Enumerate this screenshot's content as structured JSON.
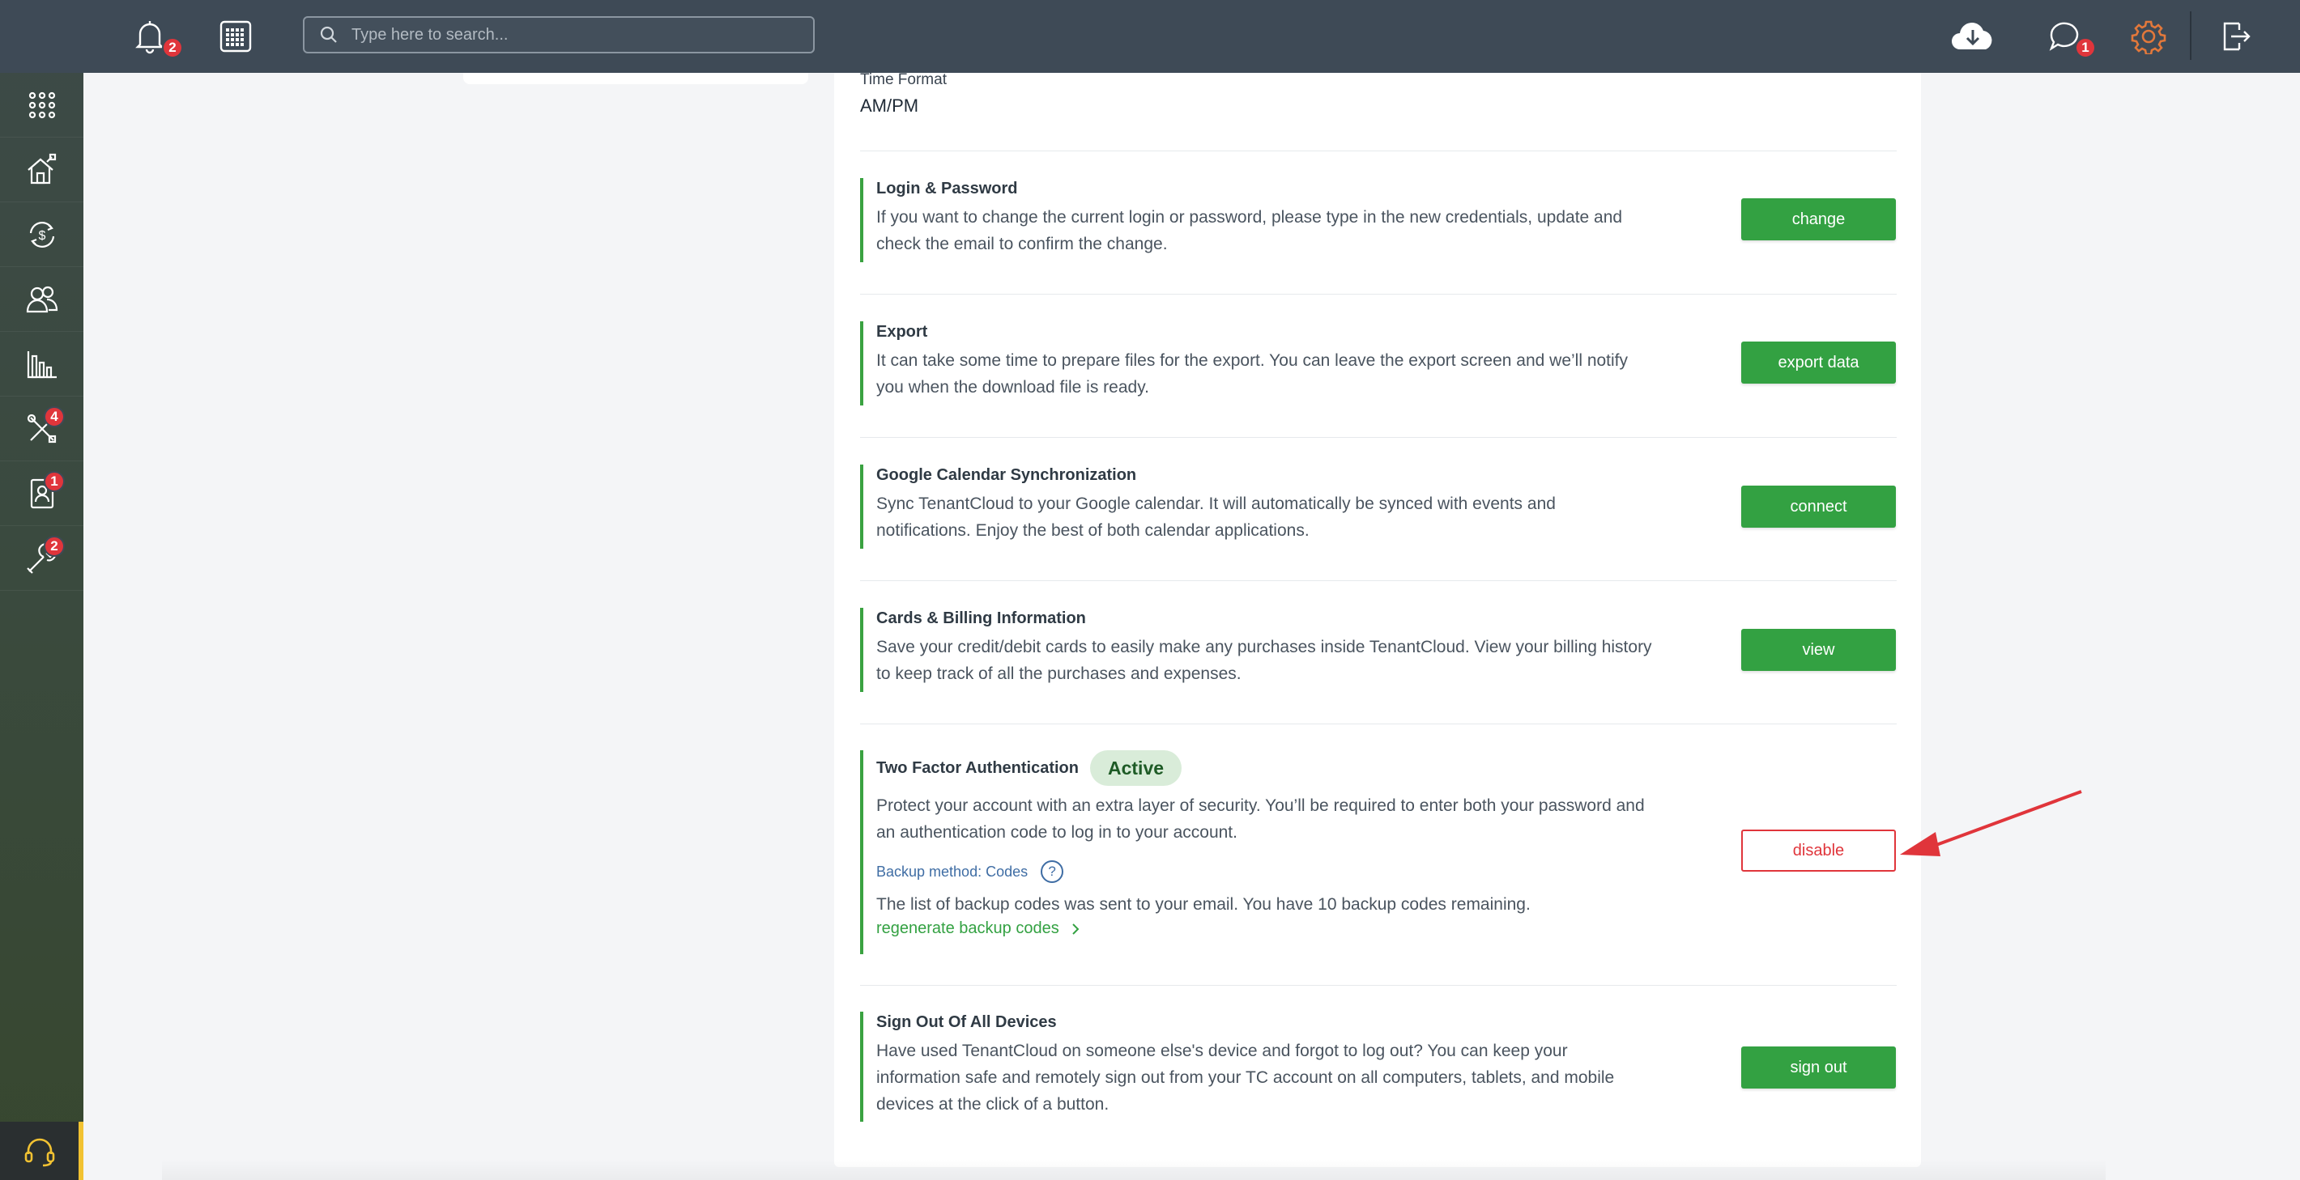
{
  "search": {
    "placeholder": "Type here to search..."
  },
  "badges": {
    "notifications": "2",
    "messages": "1",
    "tools": "4",
    "contacts": "1",
    "maintenance": "2"
  },
  "icons": {
    "notifications": "bell-icon",
    "calendar": "calendar-grid-icon",
    "search": "search-icon",
    "download": "cloud-download-icon",
    "messages": "chat-icon",
    "settings": "gear-icon",
    "logout": "logout-icon",
    "apps": "apps-grid-icon",
    "properties": "house-icon",
    "payments": "dollar-cycle-icon",
    "people": "people-icon",
    "reports": "bar-chart-icon",
    "tools": "tools-icon",
    "contacts": "contact-card-icon",
    "maintenance": "wrench-icon",
    "support": "headset-icon"
  },
  "colors": {
    "accent_green": "#33a142",
    "danger_red": "#e0353b",
    "topbar": "#3e4a56",
    "settings_orange": "#e2783b"
  },
  "settings": {
    "time_format": {
      "label": "Time Format",
      "value": "AM/PM"
    },
    "sections": [
      {
        "title": "Login & Password",
        "description": "If you want to change the current login or password, please type in the new credentials, update and check the email to confirm the change.",
        "button": "change"
      },
      {
        "title": "Export",
        "description": "It can take some time to prepare files for the export. You can leave the export screen and we’ll notify you when the download file is ready.",
        "button": "export data"
      },
      {
        "title": "Google Calendar Synchronization",
        "description": "Sync TenantCloud to your Google calendar. It will automatically be synced with events and notifications. Enjoy the best of both calendar applications.",
        "button": "connect"
      },
      {
        "title": "Cards & Billing Information",
        "description": "Save your credit/debit cards to easily make any purchases inside TenantCloud. View your billing history to keep track of all the purchases and expenses.",
        "button": "view"
      },
      {
        "title": "Two Factor Authentication",
        "status": "Active",
        "description": "Protect your account with an extra layer of security. You’ll be required to enter both your password and an authentication code to log in to your account.",
        "backup_method": "Backup method: Codes",
        "help": "?",
        "backup_info": "The list of backup codes was sent to your email. You have 10 backup codes remaining.",
        "link": "regenerate backup codes",
        "button": "disable"
      },
      {
        "title": "Sign Out Of All Devices",
        "description": "Have used TenantCloud on someone else's device and forgot to log out? You can keep your information safe and remotely sign out from your TC account on all computers, tablets, and mobile devices at the click of a button.",
        "button": "sign out"
      }
    ]
  }
}
